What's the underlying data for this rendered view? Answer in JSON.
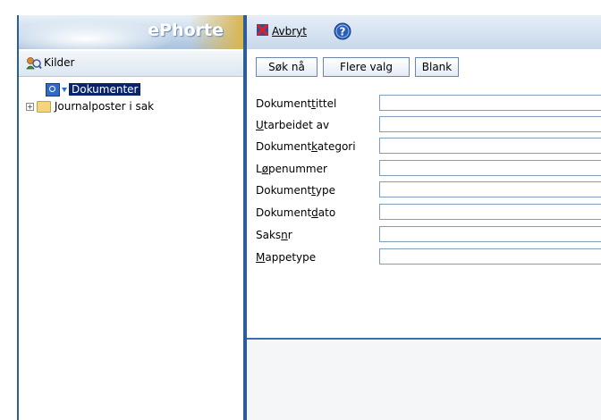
{
  "app": {
    "title": "ePhorte"
  },
  "sources": {
    "label": "Kilder"
  },
  "tree": {
    "items": [
      {
        "label": "Dokumenter",
        "selected": true
      },
      {
        "label": "Journalposter i sak",
        "selected": false
      }
    ]
  },
  "toolbar": {
    "cancel_label": "Avbryt"
  },
  "buttons": {
    "search": "Søk nå",
    "more": "Flere valg",
    "blank": "Blank"
  },
  "fields": [
    {
      "pre": "Dokument",
      "accel": "t",
      "post": "ittel",
      "value": ""
    },
    {
      "pre": "",
      "accel": "U",
      "post": "tarbeidet av",
      "value": ""
    },
    {
      "pre": "Dokument",
      "accel": "k",
      "post": "ategori",
      "value": ""
    },
    {
      "pre": "L",
      "accel": "ø",
      "post": "penummer",
      "value": ""
    },
    {
      "pre": "Dokument",
      "accel": "t",
      "post": "ype",
      "value": ""
    },
    {
      "pre": "Dokument",
      "accel": "d",
      "post": "ato",
      "value": ""
    },
    {
      "pre": "Saks",
      "accel": "n",
      "post": "r",
      "value": ""
    },
    {
      "pre": "",
      "accel": "M",
      "post": "appetype",
      "value": ""
    }
  ]
}
